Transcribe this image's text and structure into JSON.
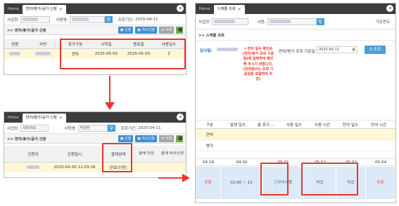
{
  "panel1": {
    "tabs": {
      "home": "Home",
      "active": "연차/병가/공가 신청"
    },
    "form": {
      "employer_label": "사업장:",
      "employee_label": "사원명:",
      "period_label": "조회기간:",
      "period_value": "2025-04-11"
    },
    "section_title": ">> 연차/휴가/공가 신청",
    "buttons": {
      "apply": "신청",
      "cancel_apply": "취소신청",
      "delete": "삭제"
    },
    "columns": [
      "성명",
      "사번",
      "휴가구분",
      "시작일",
      "종료일",
      "사용일수"
    ],
    "row": {
      "leave_type": "연차",
      "start": "2025-05-02",
      "end": "2025-05-03",
      "days": "2"
    }
  },
  "panel2": {
    "tabs": {
      "home": "Home",
      "active": "연차/병가/공가 신청"
    },
    "form": {
      "employer_label": "사업장:",
      "employer_value": "SEJONG",
      "employee_label": "사원명:",
      "employee_value": "박윤환",
      "period_label": "조회기간:",
      "period_value": "2025-04-11"
    },
    "section_title": ">> 연차/휴가/공가 신청",
    "buttons": {
      "apply": "신청",
      "cancel_apply": "취소신청",
      "delete": "삭제"
    },
    "columns": [
      "신청자",
      "신청일시",
      "결재상태",
      "결재 신청",
      "결재 취소신청"
    ],
    "row": {
      "datetime": "2025-04-30 11:03:26",
      "status": "완료(신청)"
    }
  },
  "panel3": {
    "tabs": {
      "home": "Home",
      "active": "스케줄 조회"
    },
    "form": {
      "employer_label": "사업장:",
      "employee_label": "사원:",
      "base_year_label": "기준연도:"
    },
    "section_title": ">> 스케줄 조회",
    "hire_label": "입사일:",
    "notice": "• 잔여 일수 확인은 (연차/병가 조회 기준일)에 입력하여 확인해 주시기 바랍니다. (잔여일수는 조회 기준일을 포함하여 차감)",
    "query_label": "연차/병가 조회 기준일:",
    "query_date": "2025-05-11",
    "query_button": "조회",
    "columns": [
      "구분",
      "발생 일수",
      "총 휴가 ...",
      "사용 일수",
      "사용 시간",
      "잔여 일수",
      "잔여 시간"
    ],
    "rows": [
      "연차",
      "병가"
    ],
    "calendar": {
      "dates": [
        "04.29",
        "04.30",
        "05.01",
        "05.02",
        "05.03",
        "05.04"
      ],
      "events": [
        "주휴",
        "02:00 ~ 11",
        "근무미이행",
        "파업",
        "파업",
        "주휴"
      ]
    }
  },
  "colors": {
    "accent_blue": "#3d8fd6",
    "highlight_red": "#e8362a",
    "row_yellow": "#fff7d6"
  }
}
